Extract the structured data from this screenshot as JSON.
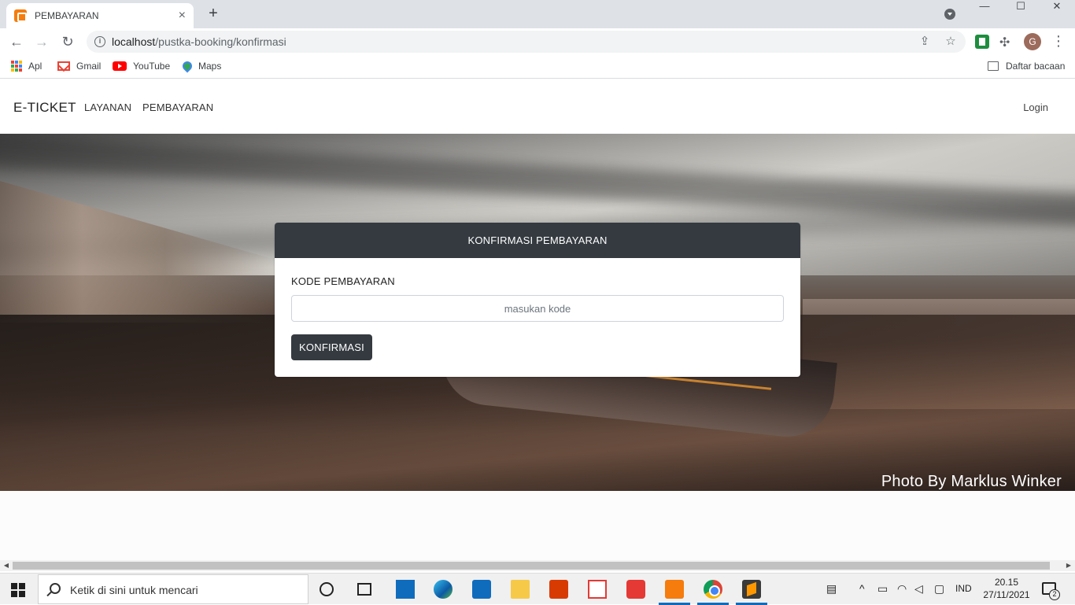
{
  "browser": {
    "tab": {
      "title": "PEMBAYARAN",
      "icon": "xampp-icon"
    },
    "url": {
      "host": "localhost",
      "path": "/pustka-booking/konfirmasi"
    },
    "bookmarks": [
      {
        "label": "Apl",
        "icon": "apps-icon"
      },
      {
        "label": "Gmail",
        "icon": "gmail-icon"
      },
      {
        "label": "YouTube",
        "icon": "youtube-icon"
      },
      {
        "label": "Maps",
        "icon": "maps-icon"
      }
    ],
    "reading_list": "Daftar bacaan",
    "profile_initial": "G"
  },
  "site": {
    "brand": "E-TICKET",
    "nav": [
      "LAYANAN",
      "PEMBAYARAN"
    ],
    "login": "Login"
  },
  "hero": {
    "credit": "Photo By Marklus Winker"
  },
  "form": {
    "header": "KONFIRMASI PEMBAYARAN",
    "label": "KODE PEMBAYARAN",
    "placeholder": "masukan kode",
    "value": "",
    "submit": "KONFIRMASI"
  },
  "taskbar": {
    "search_placeholder": "Ketik di sini untuk mencari",
    "language": "IND",
    "time": "20.15",
    "date": "27/11/2021",
    "notifications": "2"
  },
  "colors": {
    "dark": "#343a40",
    "tab_accent": "#f57c0d"
  }
}
